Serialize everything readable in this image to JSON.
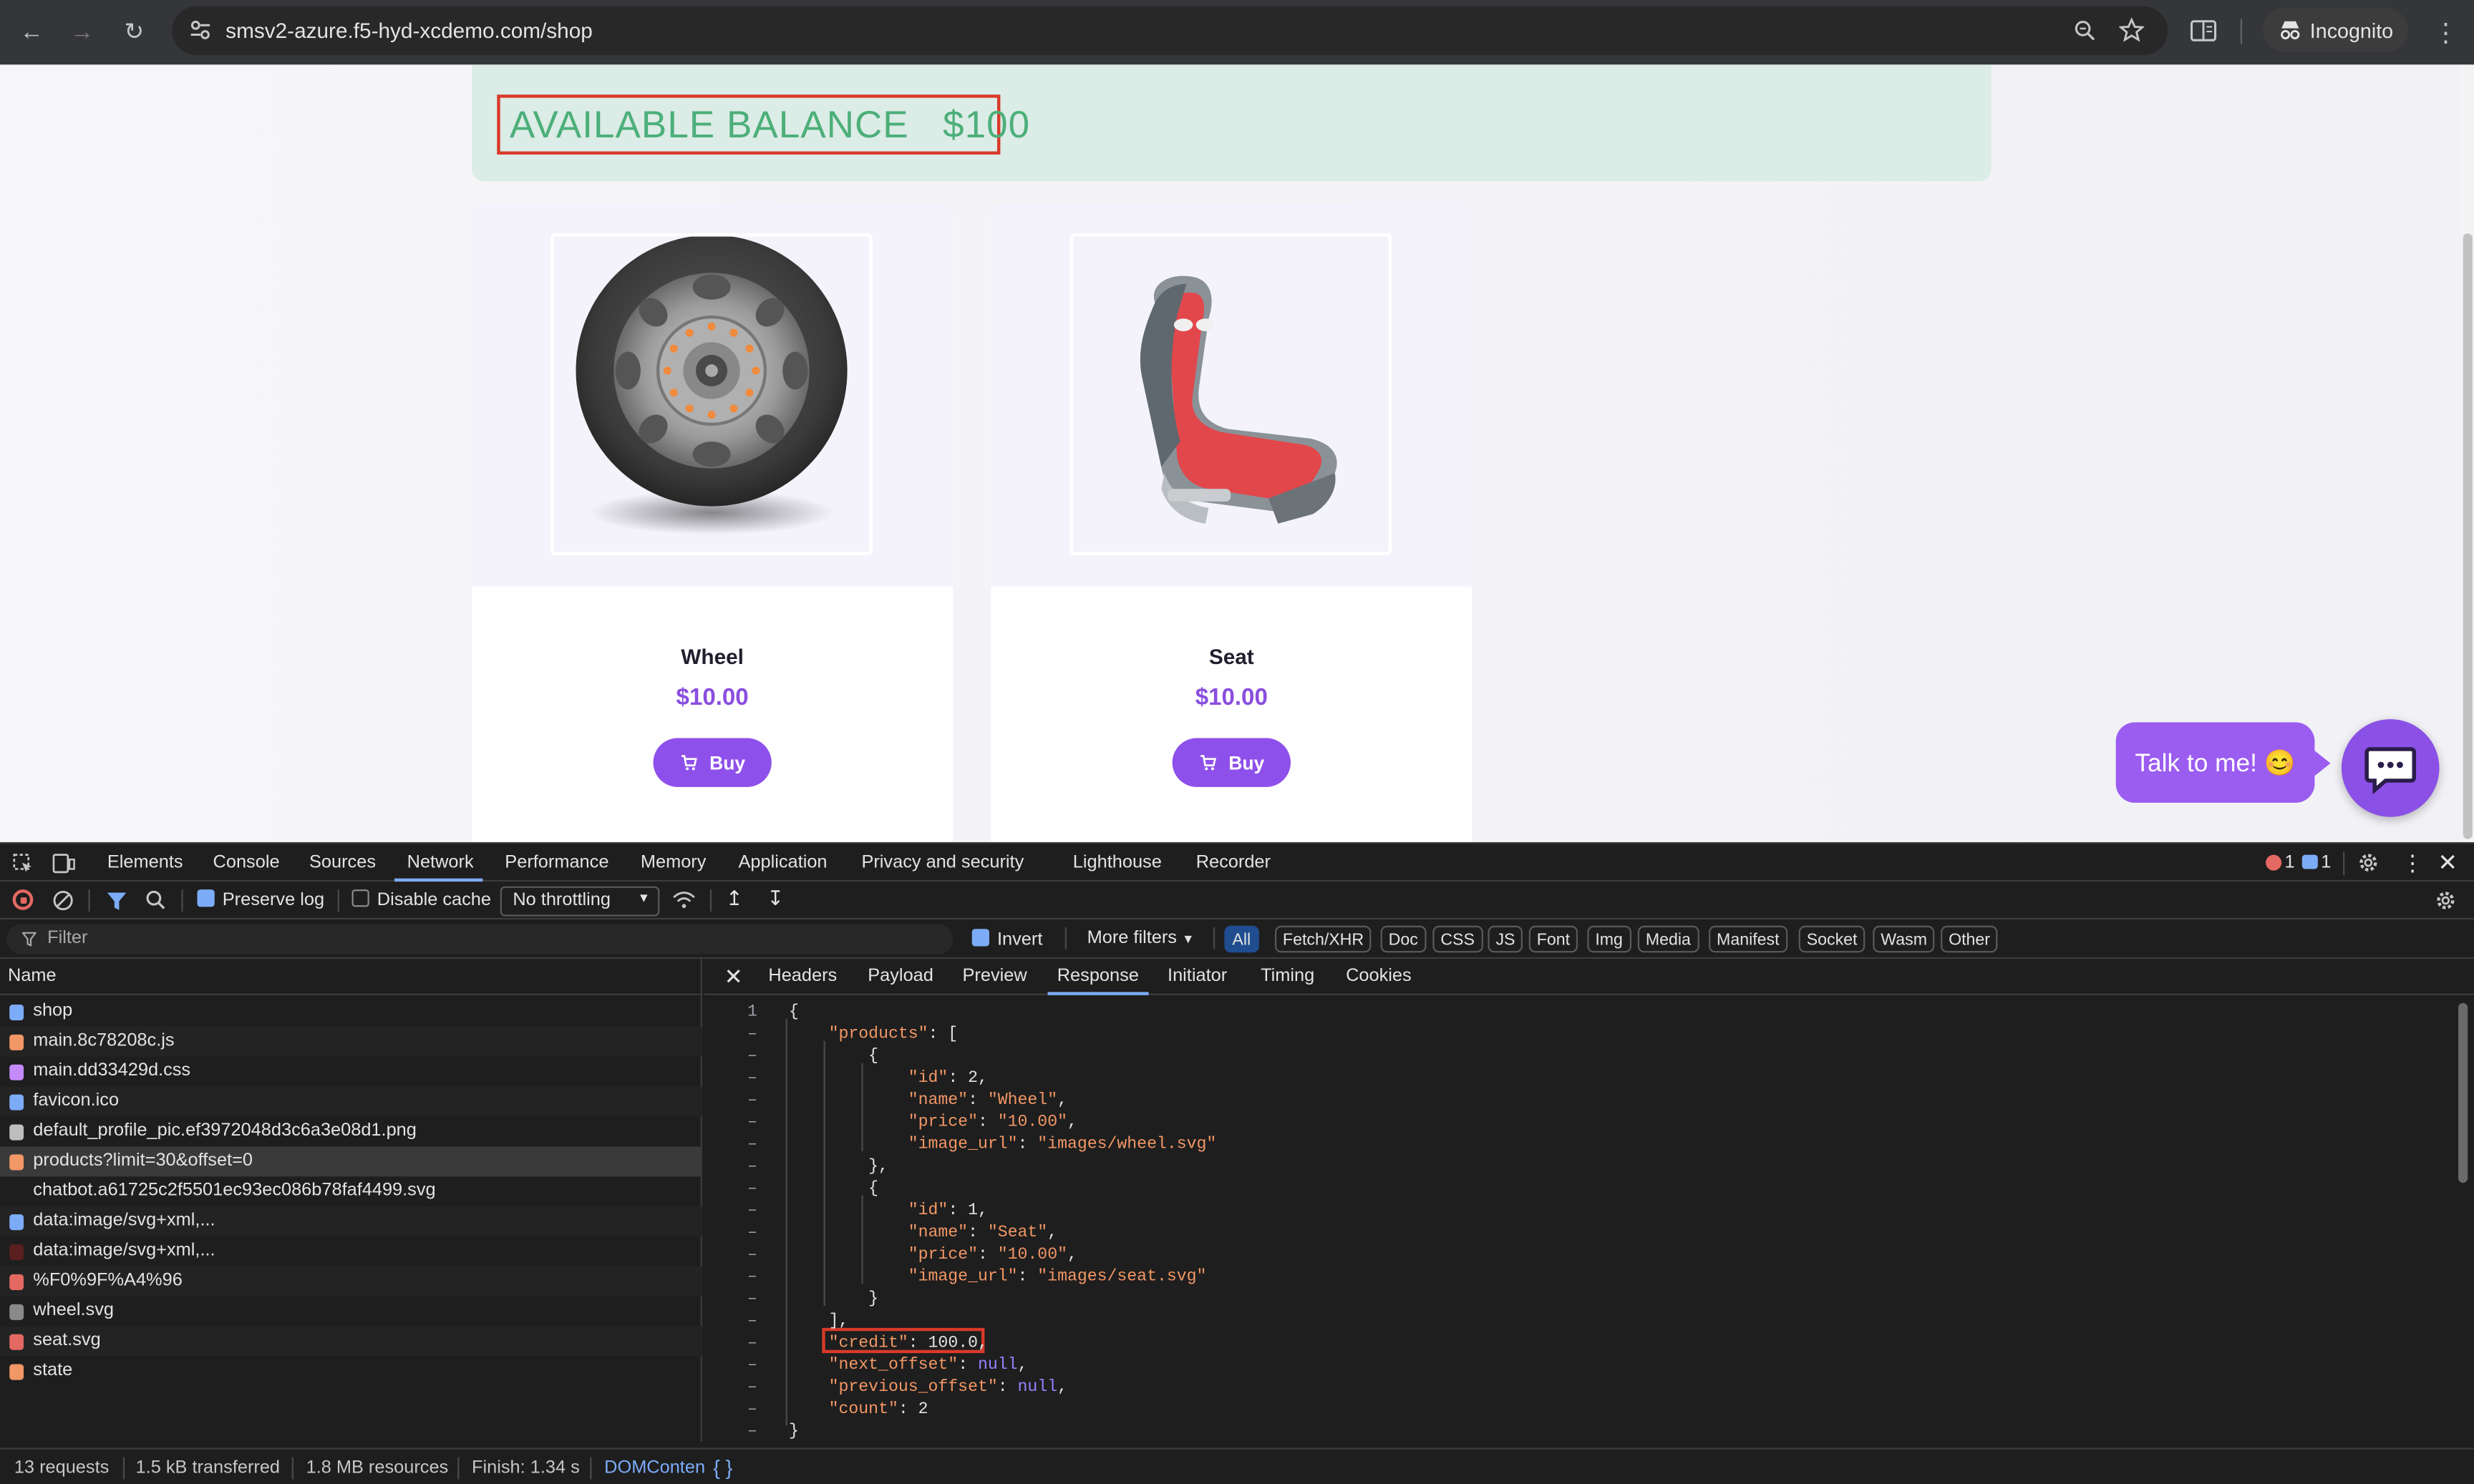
{
  "browser": {
    "url": "smsv2-azure.f5-hyd-xcdemo.com/shop",
    "profile_label": "Incognito",
    "icons": [
      "back-icon",
      "forward-icon",
      "reload-icon",
      "site-settings-icon",
      "zoom-icon",
      "star-icon",
      "reading-mode-icon",
      "incognito-icon",
      "menu-icon"
    ]
  },
  "shop": {
    "balance_label": "AVAILABLE BALANCE",
    "balance_value": "$100",
    "products": [
      {
        "name": "Wheel",
        "price": "$10.00",
        "buy_label": "Buy"
      },
      {
        "name": "Seat",
        "price": "$10.00",
        "buy_label": "Buy"
      }
    ],
    "chat_prompt": "Talk to me! 😊"
  },
  "devtools": {
    "tabs": [
      "Elements",
      "Console",
      "Sources",
      "Network",
      "Performance",
      "Memory",
      "Application",
      "Privacy and security",
      "Lighthouse",
      "Recorder"
    ],
    "active_tab": "Network",
    "error_count": "1",
    "message_count": "1",
    "toolbar": {
      "preserve_log": "Preserve log",
      "disable_cache": "Disable cache",
      "throttling": "No throttling"
    },
    "filter": {
      "placeholder": "Filter",
      "invert": "Invert",
      "more_filters": "More filters",
      "types": [
        "All",
        "Fetch/XHR",
        "Doc",
        "CSS",
        "JS",
        "Font",
        "Img",
        "Media",
        "Manifest",
        "Socket",
        "Wasm",
        "Other"
      ]
    },
    "name_header": "Name",
    "requests": [
      {
        "name": "shop",
        "icon_color": "#7cacf8"
      },
      {
        "name": "main.8c78208c.js",
        "icon_color": "#f29766"
      },
      {
        "name": "main.dd33429d.css",
        "icon_color": "#c58af9"
      },
      {
        "name": "favicon.ico",
        "icon_color": "#7cacf8"
      },
      {
        "name": "default_profile_pic.ef3972048d3c6a3e08d1.png",
        "icon_color": "#bdbdbd"
      },
      {
        "name": "products?limit=30&offset=0",
        "icon_color": "#f29766"
      },
      {
        "name": "chatbot.a61725c2f5501ec93ec086b78faf4499.svg",
        "icon_color": "#1e1e1e"
      },
      {
        "name": "data:image/svg+xml,...",
        "icon_color": "#7cacf8"
      },
      {
        "name": "data:image/svg+xml,...",
        "icon_color": "#5a1f1f"
      },
      {
        "name": "%F0%9F%A4%96",
        "icon_color": "#e46962"
      },
      {
        "name": "wheel.svg",
        "icon_color": "#8a8a8a"
      },
      {
        "name": "seat.svg",
        "icon_color": "#e46962"
      },
      {
        "name": "state",
        "icon_color": "#f29766"
      }
    ],
    "detail_tabs": [
      "Headers",
      "Payload",
      "Preview",
      "Response",
      "Initiator",
      "Timing",
      "Cookies"
    ],
    "active_detail_tab": "Response",
    "response_first_line_number": "1",
    "response_line_marker": "–",
    "response_lines": [
      "{",
      "    \"products\": [",
      "        {",
      "            \"id\": 2,",
      "            \"name\": \"Wheel\",",
      "            \"price\": \"10.00\",",
      "            \"image_url\": \"images/wheel.svg\"",
      "        },",
      "        {",
      "            \"id\": 1,",
      "            \"name\": \"Seat\",",
      "            \"price\": \"10.00\",",
      "            \"image_url\": \"images/seat.svg\"",
      "        }",
      "    ],",
      "    \"credit\": 100.0,",
      "    \"next_offset\": null,",
      "    \"previous_offset\": null,",
      "    \"count\": 2",
      "}"
    ],
    "status": {
      "requests": "13 requests",
      "transferred": "1.5 kB transferred",
      "resources": "1.8 MB resources",
      "finish": "Finish: 1.34 s",
      "dom": "DOMConten",
      "braces": "{ }"
    }
  },
  "colors": {
    "accent": "#8e50ea",
    "balance_text": "#4caf7a",
    "highlight_box": "#d83a2a"
  }
}
